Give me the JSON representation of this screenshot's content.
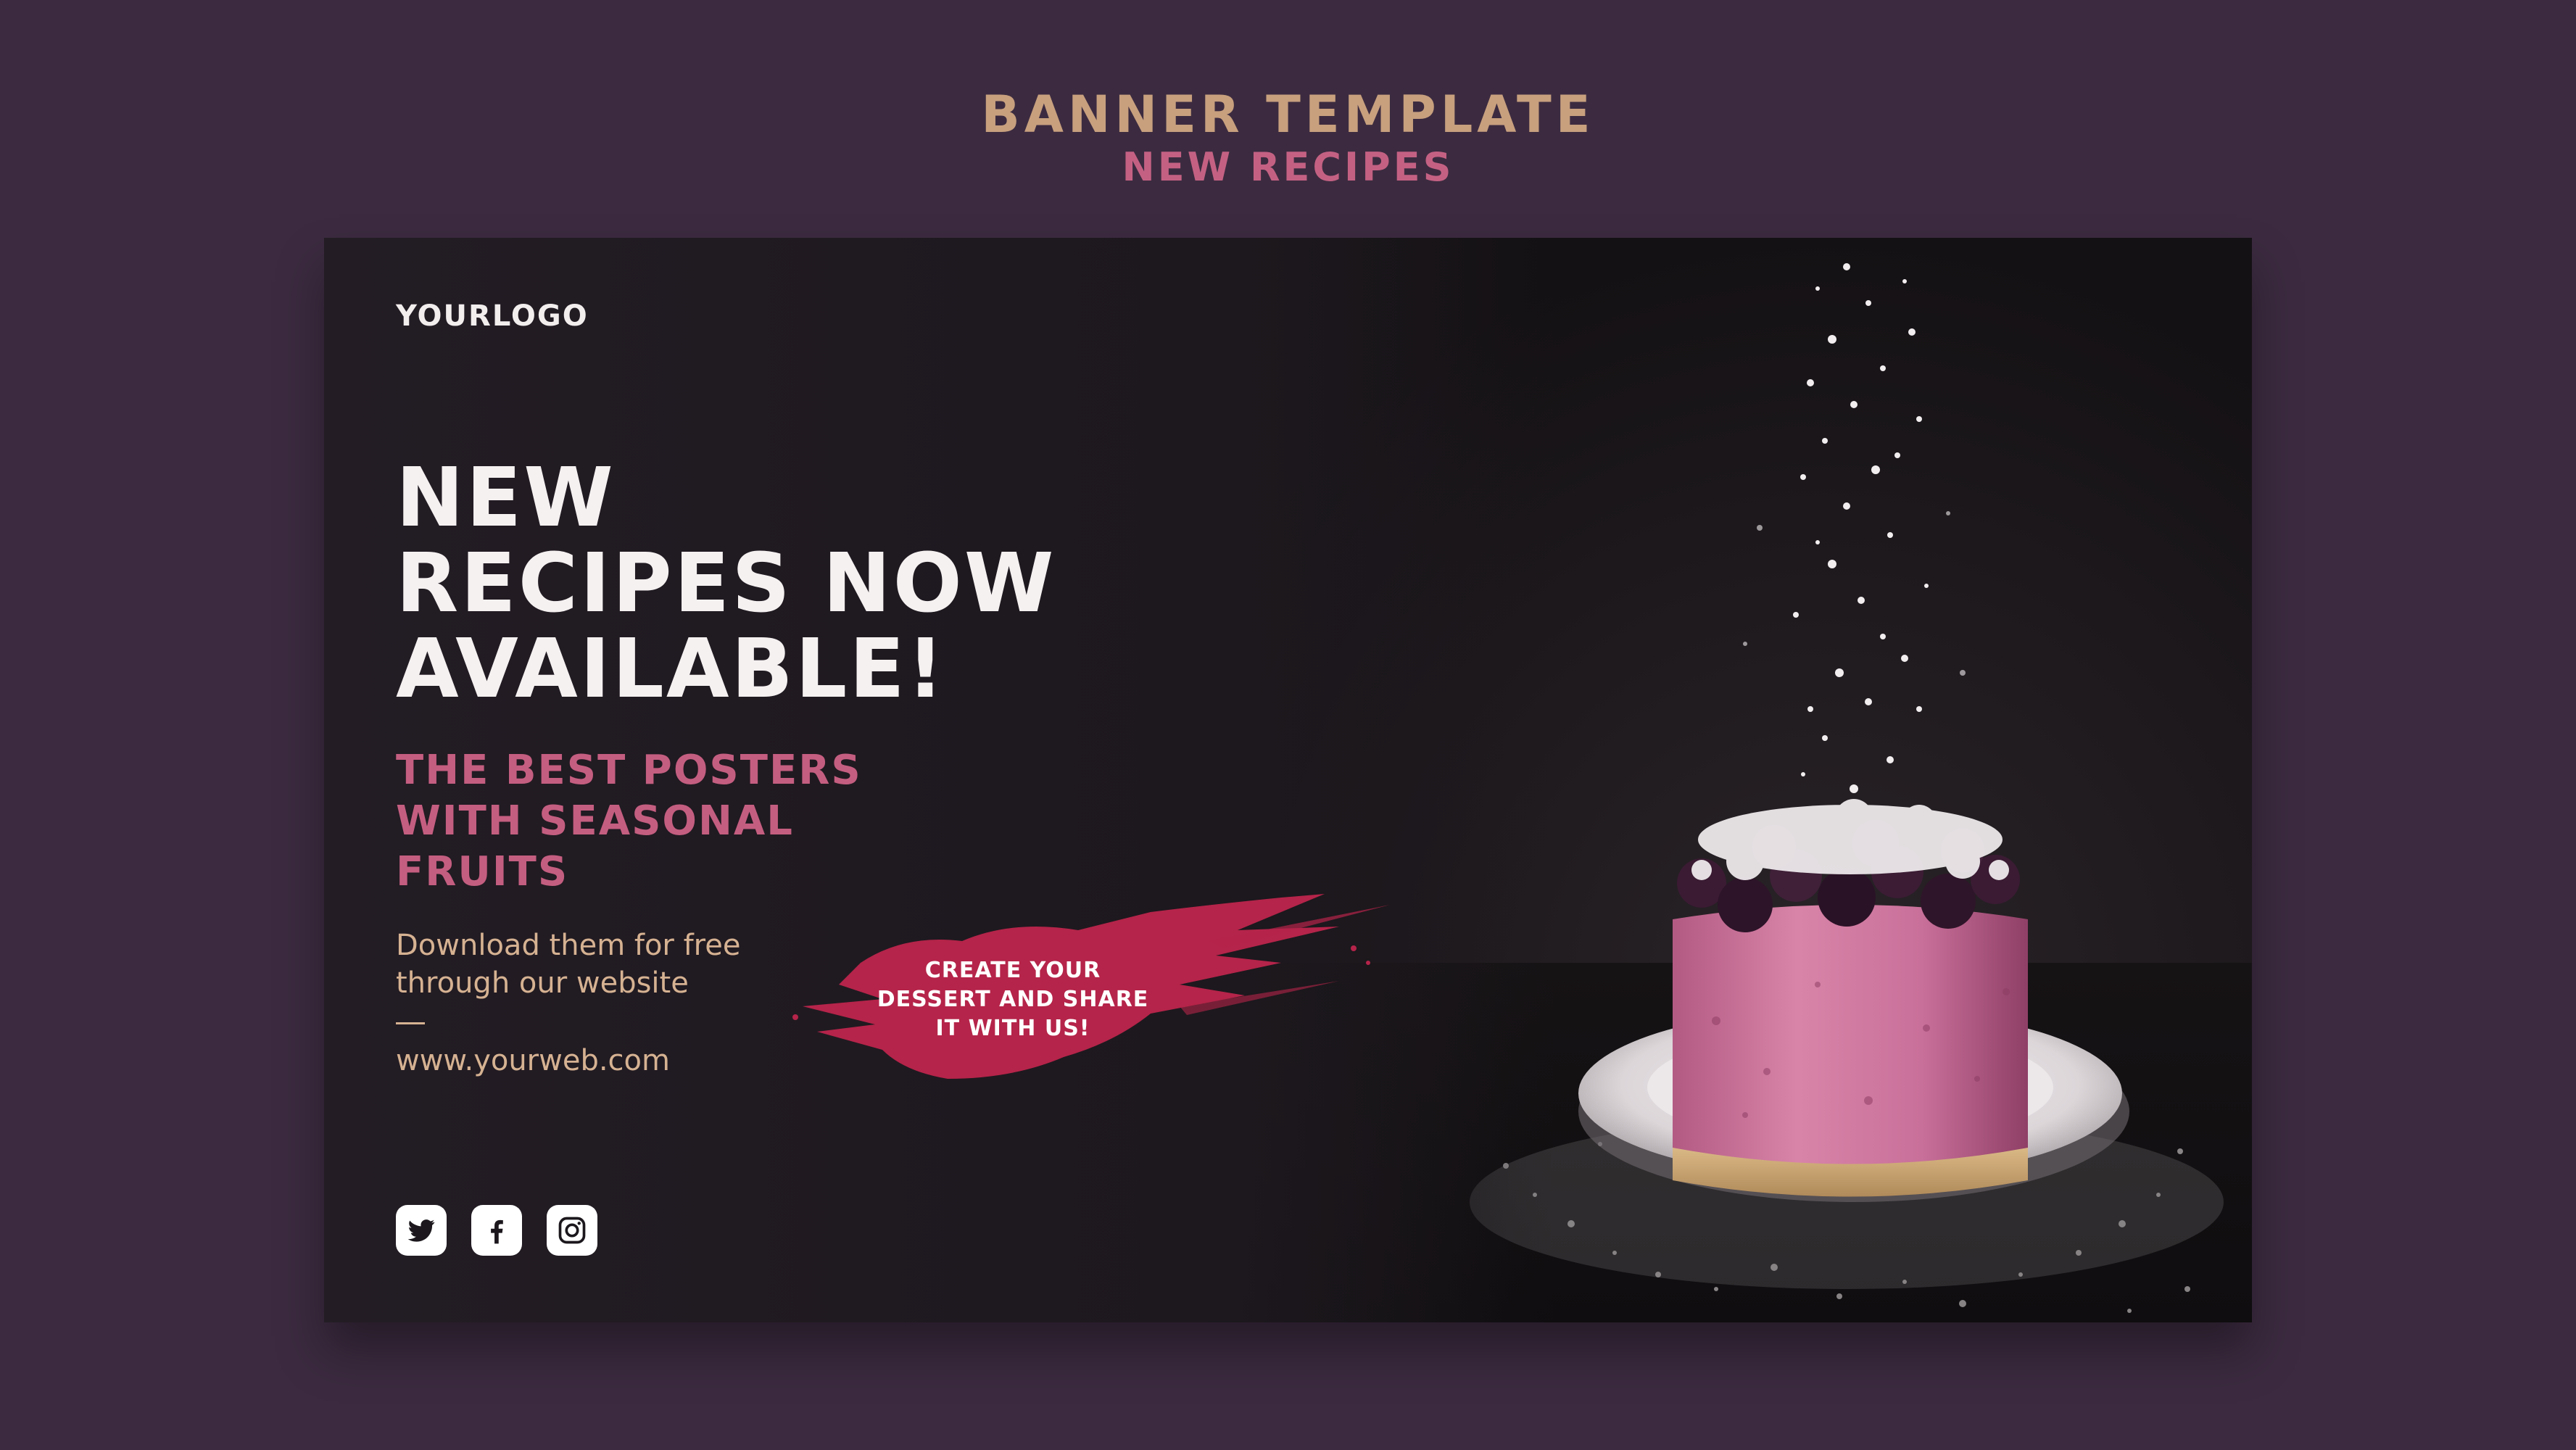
{
  "header": {
    "title": "BANNER TEMPLATE",
    "subtitle": "NEW RECIPES"
  },
  "banner": {
    "logo": "YOURLOGO",
    "headline_lines": [
      "NEW",
      "RECIPES NOW",
      "AVAILABLE!"
    ],
    "subhead_lines": [
      "THE BEST POSTERS",
      "WITH SEASONAL",
      "FRUITS"
    ],
    "description_lines": [
      "Download them for free",
      "through our website"
    ],
    "url": "www.yourweb.com",
    "cta_lines": [
      "CREATE YOUR",
      "DESSERT AND SHARE",
      "IT WITH US!"
    ],
    "social": [
      "twitter-icon",
      "facebook-icon",
      "instagram-icon"
    ]
  },
  "colors": {
    "background": "#3c2b40",
    "banner": "#1b171c",
    "gold": "#c8a07e",
    "pink": "#c45e80",
    "brush": "#b5244a",
    "text_light": "#f5f1f1",
    "text_tan": "#d6b292"
  }
}
